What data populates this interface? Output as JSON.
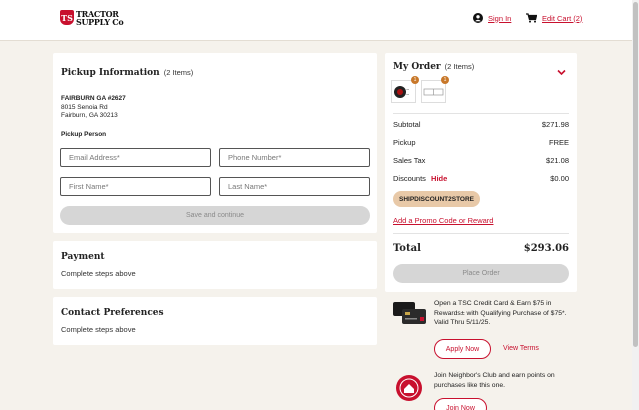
{
  "header": {
    "logo_top": "TRACTOR",
    "logo_bottom": "SUPPLY Co",
    "logo_mark": "TS",
    "sign_in": "Sign In",
    "edit_cart": "Edit Cart (2)"
  },
  "pickup": {
    "title": "Pickup Information",
    "count": "(2 Items)",
    "store_name": "FAIRBURN GA #2627",
    "address1": "8015 Senoia Rd",
    "address2": "Fairburn, GA 30213",
    "person_label": "Pickup Person",
    "email_placeholder": "Email Address*",
    "phone_placeholder": "Phone Number*",
    "first_placeholder": "First Name*",
    "last_placeholder": "Last Name*",
    "save_button": "Save and continue"
  },
  "payment": {
    "title": "Payment",
    "subtitle": "Complete steps above"
  },
  "contact": {
    "title": "Contact Preferences",
    "subtitle": "Complete steps above"
  },
  "order": {
    "title": "My Order",
    "count": "(2 Items)",
    "thumb1_qty": "1",
    "thumb2_qty": "1",
    "subtotal_label": "Subtotal",
    "subtotal_value": "$271.98",
    "pickup_label": "Pickup",
    "pickup_value": "FREE",
    "tax_label": "Sales Tax",
    "tax_value": "$21.08",
    "discounts_label": "Discounts",
    "discounts_toggle": "Hide",
    "discounts_value": "$0.00",
    "promo_code": "SHIPDISCOUNT2STORE",
    "promo_link": "Add a Promo Code or Reward",
    "total_label": "Total",
    "total_value": "$293.06",
    "place_order": "Place Order"
  },
  "credit": {
    "text": "Open a TSC Credit Card & Earn $75 in Rewards± with Qualifying Purchase of $75*. Valid Thru 5/11/25.",
    "apply": "Apply Now",
    "terms": "View Terms"
  },
  "club": {
    "text": "Join Neighbor's Club and earn points on purchases like this one.",
    "join": "Join Now"
  },
  "colors": {
    "brand_red": "#c8102e",
    "background": "#f5f2ec",
    "promo_chip": "#e8c9a8"
  }
}
